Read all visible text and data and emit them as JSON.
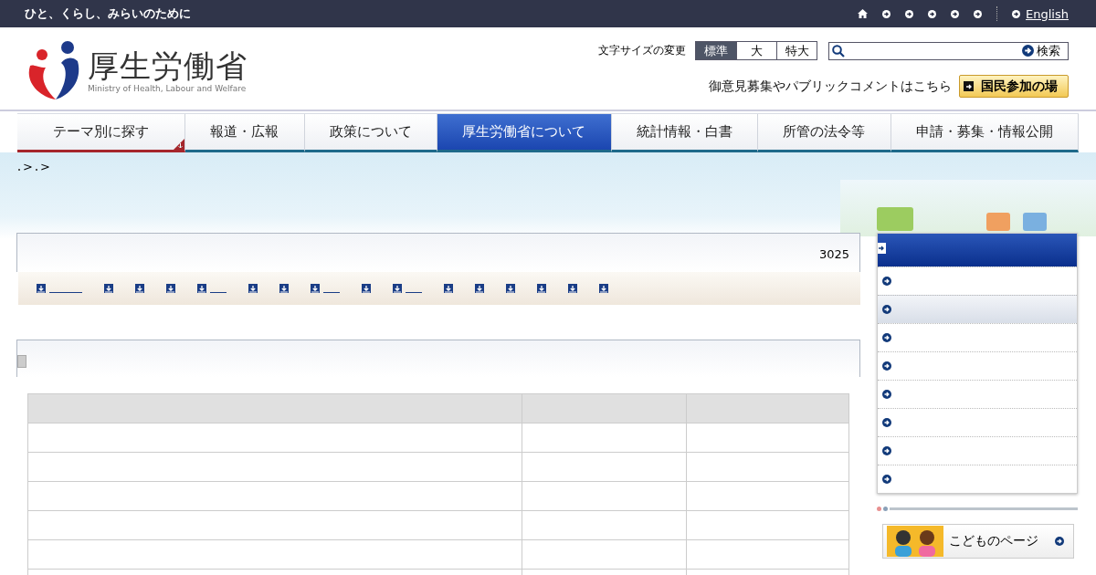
{
  "top_bar": {
    "tagline": "ひと、くらし、みらいのために",
    "english_link": "English"
  },
  "header": {
    "logo_name": "厚生労働省",
    "logo_subtitle": "Ministry of Health, Labour and Welfare",
    "font_size_label": "文字サイズの変更",
    "font_sizes": [
      {
        "label": "標準",
        "selected": true
      },
      {
        "label": "大",
        "selected": false
      },
      {
        "label": "特大",
        "selected": false
      }
    ],
    "search_button": "検索",
    "comment_link": "御意見募集やパブリックコメントはこちら",
    "participation_button": "国民参加の場"
  },
  "nav": [
    {
      "label": "テーマ別に探す",
      "kind": "dropdown",
      "selected": false
    },
    {
      "label": "報道・広報",
      "kind": "link",
      "selected": false
    },
    {
      "label": "政策について",
      "kind": "link",
      "selected": false
    },
    {
      "label": "厚生労働省について",
      "kind": "link",
      "selected": true
    },
    {
      "label": "統計情報・白書",
      "kind": "link",
      "selected": false
    },
    {
      "label": "所管の法令等",
      "kind": "link",
      "selected": false
    },
    {
      "label": "申請・募集・情報公開",
      "kind": "link",
      "selected": false
    }
  ],
  "breadcrumb": [
    ">",
    ">"
  ],
  "page_number": "3025",
  "sidebar": {
    "items": [
      {
        "selected": false
      },
      {
        "selected": true
      },
      {
        "selected": false
      },
      {
        "selected": false
      },
      {
        "selected": false
      },
      {
        "selected": false
      },
      {
        "selected": false
      },
      {
        "selected": false
      }
    ]
  },
  "kids_banner": "こどものページ"
}
